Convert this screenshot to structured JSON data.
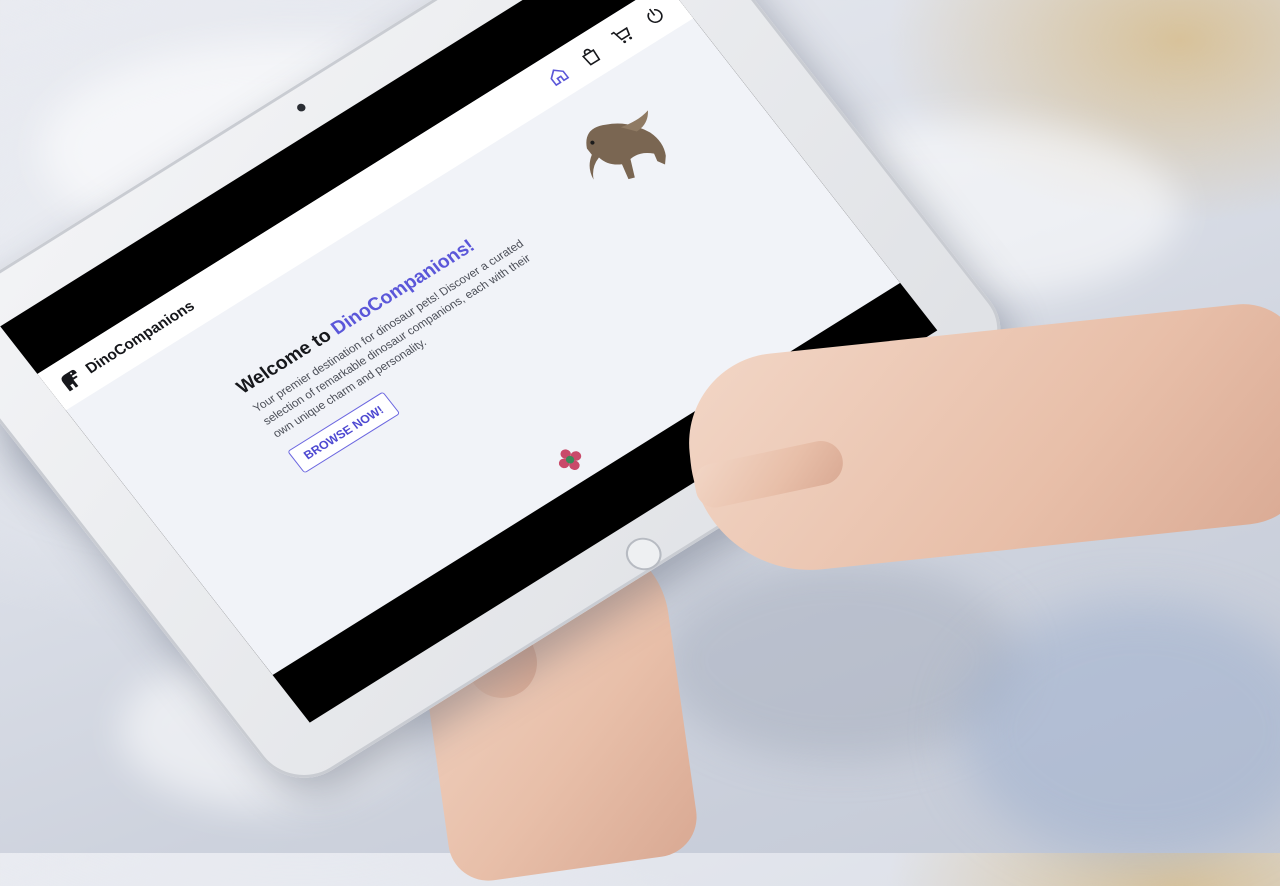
{
  "brand": {
    "name": "DinoCompanions"
  },
  "nav": [
    {
      "icon": "home-icon",
      "active": true
    },
    {
      "icon": "shopping-bag-icon",
      "active": false
    },
    {
      "icon": "cart-icon",
      "active": false
    },
    {
      "icon": "logout-icon",
      "active": false
    }
  ],
  "hero": {
    "title_prefix": "Welcome to ",
    "title_accent": "DinoCompanions!",
    "description": "Your premier destination for dinosaur pets! Discover a curated selection of remarkable dinosaur companions, each with their own unique charm and personality.",
    "cta_label": "BROWSE NOW!"
  },
  "colors": {
    "accent": "#5b57d9",
    "background": "#f1f3f8",
    "topbar": "#ffffff"
  }
}
